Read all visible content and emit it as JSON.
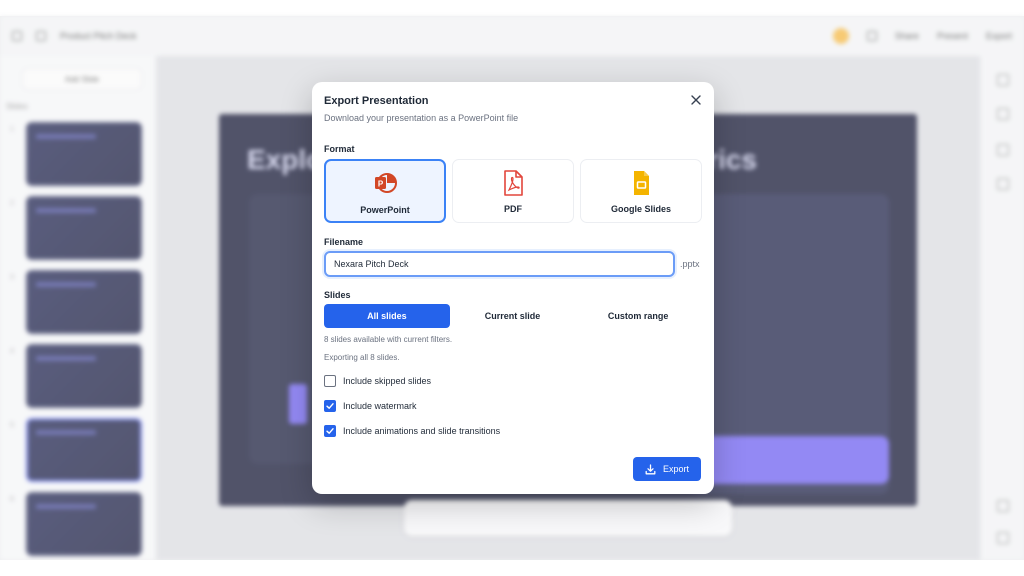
{
  "background": {
    "app_title": "Product Pitch Deck",
    "add_slide_label": "Add Slide",
    "slides_label": "Slides",
    "toolbar_items": [
      "Share",
      "Present",
      "Export"
    ],
    "slide_title_left": "Explo",
    "slide_title_right": "rics",
    "slide_numbers": [
      "1",
      "2",
      "3",
      "4",
      "5",
      "6"
    ]
  },
  "modal": {
    "title": "Export Presentation",
    "subtitle": "Download your presentation as a PowerPoint file",
    "format_label": "Format",
    "formats": [
      {
        "label": "PowerPoint",
        "icon": "powerpoint-icon",
        "selected": true,
        "color": "#d24726"
      },
      {
        "label": "PDF",
        "icon": "pdf-icon",
        "selected": false,
        "color": "#e2463c"
      },
      {
        "label": "Google Slides",
        "icon": "google-slides-icon",
        "selected": false,
        "color": "#f4b400"
      }
    ],
    "filename_label": "Filename",
    "filename_value": "Nexara Pitch Deck",
    "extension": ".pptx",
    "slides_label": "Slides",
    "slide_options": [
      {
        "label": "All slides",
        "active": true
      },
      {
        "label": "Current slide",
        "active": false
      },
      {
        "label": "Custom range",
        "active": false
      }
    ],
    "available_text": "8 slides available with current filters.",
    "exporting_text": "Exporting all 8 slides.",
    "options": [
      {
        "label": "Include skipped slides",
        "checked": false
      },
      {
        "label": "Include watermark",
        "checked": true
      },
      {
        "label": "Include animations and slide transitions",
        "checked": true
      }
    ],
    "export_label": "Export"
  },
  "colors": {
    "accent": "#2563eb",
    "selected_border": "#3b82f6"
  }
}
